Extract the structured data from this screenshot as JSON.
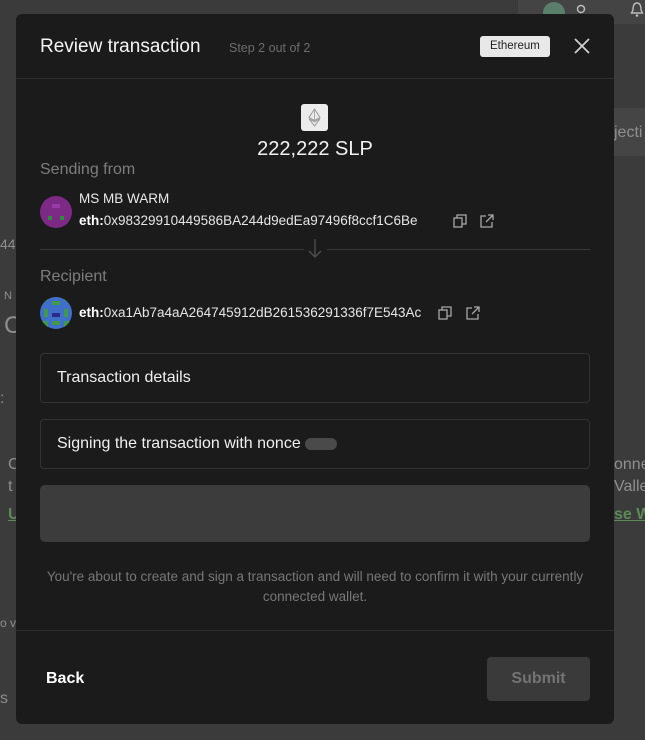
{
  "background": {
    "right_snippet": "jecti",
    "left_fragments": [
      "44",
      "N",
      "C",
      ":",
      "C",
      "t",
      "U",
      "o v",
      "s"
    ],
    "right_fragments": [
      "onne",
      "Vallet",
      "se W"
    ]
  },
  "modal": {
    "title": "Review transaction",
    "step": "Step 2 out of 2",
    "network": "Ethereum",
    "close_icon": "close-icon"
  },
  "token": {
    "icon": "ethereum-icon",
    "amount": "222,222 SLP"
  },
  "sender": {
    "label": "Sending from",
    "name": "MS MB WARM",
    "address_prefix": "eth:",
    "address": "0x98329910449586BA244d9edEa97496f8ccf1C6Be"
  },
  "recipient": {
    "label": "Recipient",
    "address_prefix": "eth:",
    "address": "0xa1Ab7a4aA264745912dB261536291336f7E543Ac"
  },
  "sections": {
    "details": "Transaction details",
    "signing": "Signing the transaction with nonce"
  },
  "notice": "You're about to create and sign a transaction and will need to confirm it with your currently connected wallet.",
  "footer": {
    "back": "Back",
    "submit": "Submit"
  },
  "colors": {
    "modal_bg": "#1b1b1b",
    "overlay_bg": "#3a3a3a",
    "accent_green": "#5c8a57"
  }
}
